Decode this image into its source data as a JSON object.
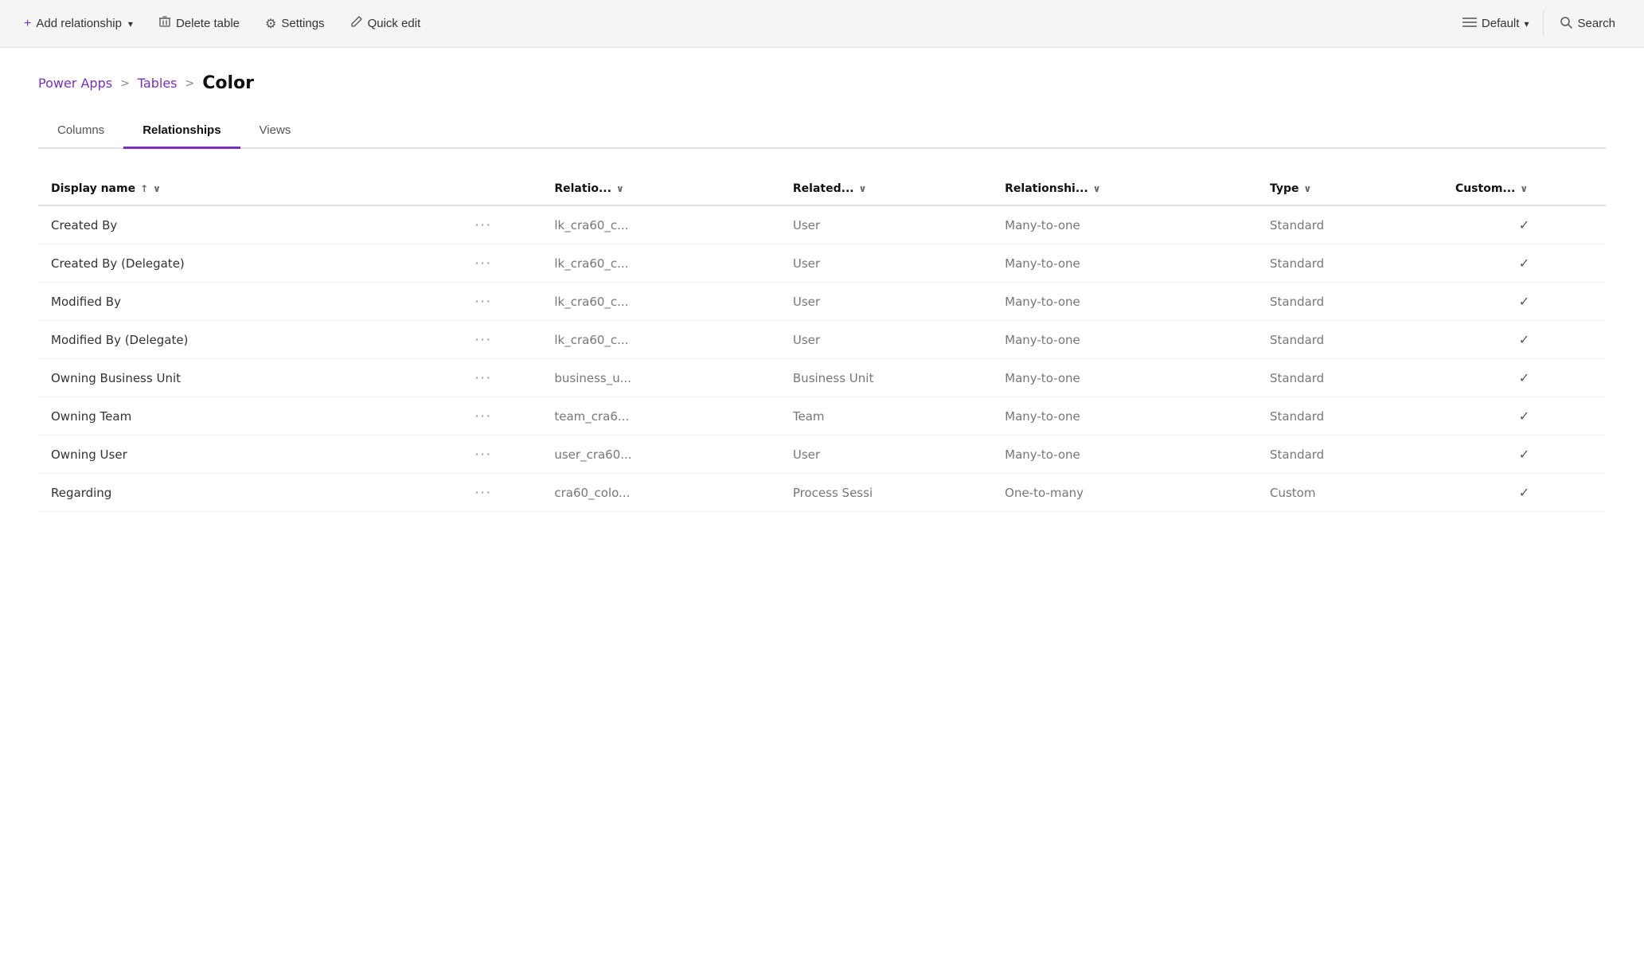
{
  "toolbar": {
    "add_label": "Add relationship",
    "add_icon": "+",
    "add_dropdown_icon": "▾",
    "delete_label": "Delete table",
    "delete_icon": "🗑",
    "settings_label": "Settings",
    "settings_icon": "⚙",
    "quickedit_label": "Quick edit",
    "quickedit_icon": "✏",
    "default_label": "Default",
    "default_icon": "≡",
    "default_dropdown_icon": "▾",
    "search_label": "Search",
    "search_icon": "🔍"
  },
  "breadcrumb": {
    "link1": "Power Apps",
    "sep1": ">",
    "link2": "Tables",
    "sep2": ">",
    "current": "Color"
  },
  "tabs": [
    {
      "label": "Columns",
      "active": false
    },
    {
      "label": "Relationships",
      "active": true
    },
    {
      "label": "Views",
      "active": false
    }
  ],
  "table": {
    "columns": [
      {
        "label": "Display name",
        "sort": true,
        "filter": true
      },
      {
        "label": "",
        "sort": false,
        "filter": false
      },
      {
        "label": "Relatio...",
        "sort": false,
        "filter": true
      },
      {
        "label": "Related...",
        "sort": false,
        "filter": true
      },
      {
        "label": "Relationshi...",
        "sort": false,
        "filter": true
      },
      {
        "label": "Type",
        "sort": false,
        "filter": true
      },
      {
        "label": "Custom...",
        "sort": false,
        "filter": true
      }
    ],
    "rows": [
      {
        "display_name": "Created By",
        "ellipsis": "···",
        "relation": "lk_cra60_c...",
        "related": "User",
        "relationship": "Many-to-one",
        "type": "Standard",
        "custom_check": "✓"
      },
      {
        "display_name": "Created By (Delegate)",
        "ellipsis": "···",
        "relation": "lk_cra60_c...",
        "related": "User",
        "relationship": "Many-to-one",
        "type": "Standard",
        "custom_check": "✓"
      },
      {
        "display_name": "Modified By",
        "ellipsis": "···",
        "relation": "lk_cra60_c...",
        "related": "User",
        "relationship": "Many-to-one",
        "type": "Standard",
        "custom_check": "✓"
      },
      {
        "display_name": "Modified By (Delegate)",
        "ellipsis": "···",
        "relation": "lk_cra60_c...",
        "related": "User",
        "relationship": "Many-to-one",
        "type": "Standard",
        "custom_check": "✓"
      },
      {
        "display_name": "Owning Business Unit",
        "ellipsis": "···",
        "relation": "business_u...",
        "related": "Business Unit",
        "relationship": "Many-to-one",
        "type": "Standard",
        "custom_check": "✓"
      },
      {
        "display_name": "Owning Team",
        "ellipsis": "···",
        "relation": "team_cra6...",
        "related": "Team",
        "relationship": "Many-to-one",
        "type": "Standard",
        "custom_check": "✓"
      },
      {
        "display_name": "Owning User",
        "ellipsis": "···",
        "relation": "user_cra60...",
        "related": "User",
        "relationship": "Many-to-one",
        "type": "Standard",
        "custom_check": "✓"
      },
      {
        "display_name": "Regarding",
        "ellipsis": "···",
        "relation": "cra60_colo...",
        "related": "Process Sessi",
        "relationship": "One-to-many",
        "type": "Custom",
        "custom_check": "✓"
      }
    ]
  }
}
